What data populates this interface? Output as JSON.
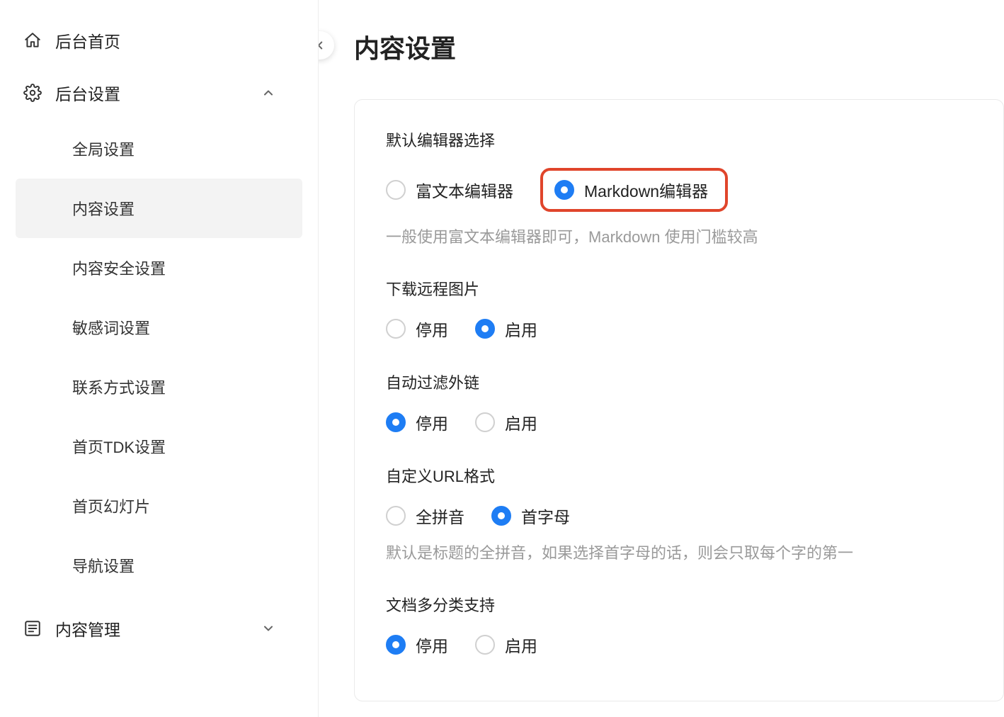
{
  "sidebar": {
    "items": [
      {
        "label": "后台首页",
        "icon": "home"
      },
      {
        "label": "后台设置",
        "icon": "gear",
        "expanded": true,
        "children": [
          {
            "label": "全局设置"
          },
          {
            "label": "内容设置",
            "active": true
          },
          {
            "label": "内容安全设置"
          },
          {
            "label": "敏感词设置"
          },
          {
            "label": "联系方式设置"
          },
          {
            "label": "首页TDK设置"
          },
          {
            "label": "首页幻灯片"
          },
          {
            "label": "导航设置"
          }
        ]
      },
      {
        "label": "内容管理",
        "icon": "list",
        "expanded": false
      }
    ]
  },
  "page": {
    "title": "内容设置"
  },
  "sections": {
    "editor": {
      "title": "默认编辑器选择",
      "options": {
        "rich": "富文本编辑器",
        "markdown": "Markdown编辑器"
      },
      "selected": "markdown",
      "hint": "一般使用富文本编辑器即可，Markdown 使用门槛较高"
    },
    "remote_img": {
      "title": "下载远程图片",
      "options": {
        "off": "停用",
        "on": "启用"
      },
      "selected": "on"
    },
    "filter_link": {
      "title": "自动过滤外链",
      "options": {
        "off": "停用",
        "on": "启用"
      },
      "selected": "off"
    },
    "url_format": {
      "title": "自定义URL格式",
      "options": {
        "pinyin": "全拼音",
        "initial": "首字母"
      },
      "selected": "initial",
      "hint": "默认是标题的全拼音，如果选择首字母的话，则会只取每个字的第一"
    },
    "multi_cat": {
      "title": "文档多分类支持",
      "options": {
        "off": "停用",
        "on": "启用"
      },
      "selected": "off"
    }
  }
}
